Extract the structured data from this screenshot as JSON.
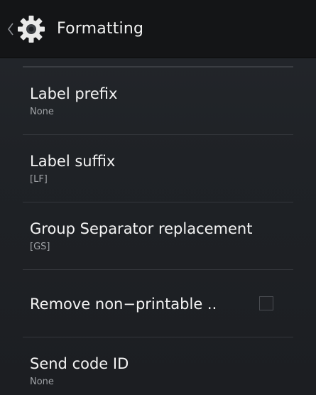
{
  "action_bar": {
    "title": "Formatting",
    "back_icon": "chevron-left-icon",
    "app_icon": "gear-icon"
  },
  "preferences": [
    {
      "title": "Label prefix",
      "summary": "None",
      "type": "text"
    },
    {
      "title": "Label suffix",
      "summary": "[LF]",
      "type": "text"
    },
    {
      "title": "Group Separator replacement",
      "summary": "[GS]",
      "type": "text"
    },
    {
      "title": "Remove non−printable ..",
      "type": "checkbox",
      "checked": false
    },
    {
      "title": "Send code ID",
      "summary": "None",
      "type": "text"
    }
  ],
  "colors": {
    "action_bar_bg": "#141517",
    "background": "#1f2226",
    "title_text": "#f4f4f4",
    "summary_text": "#9fa2a6",
    "divider": "#34373c"
  }
}
